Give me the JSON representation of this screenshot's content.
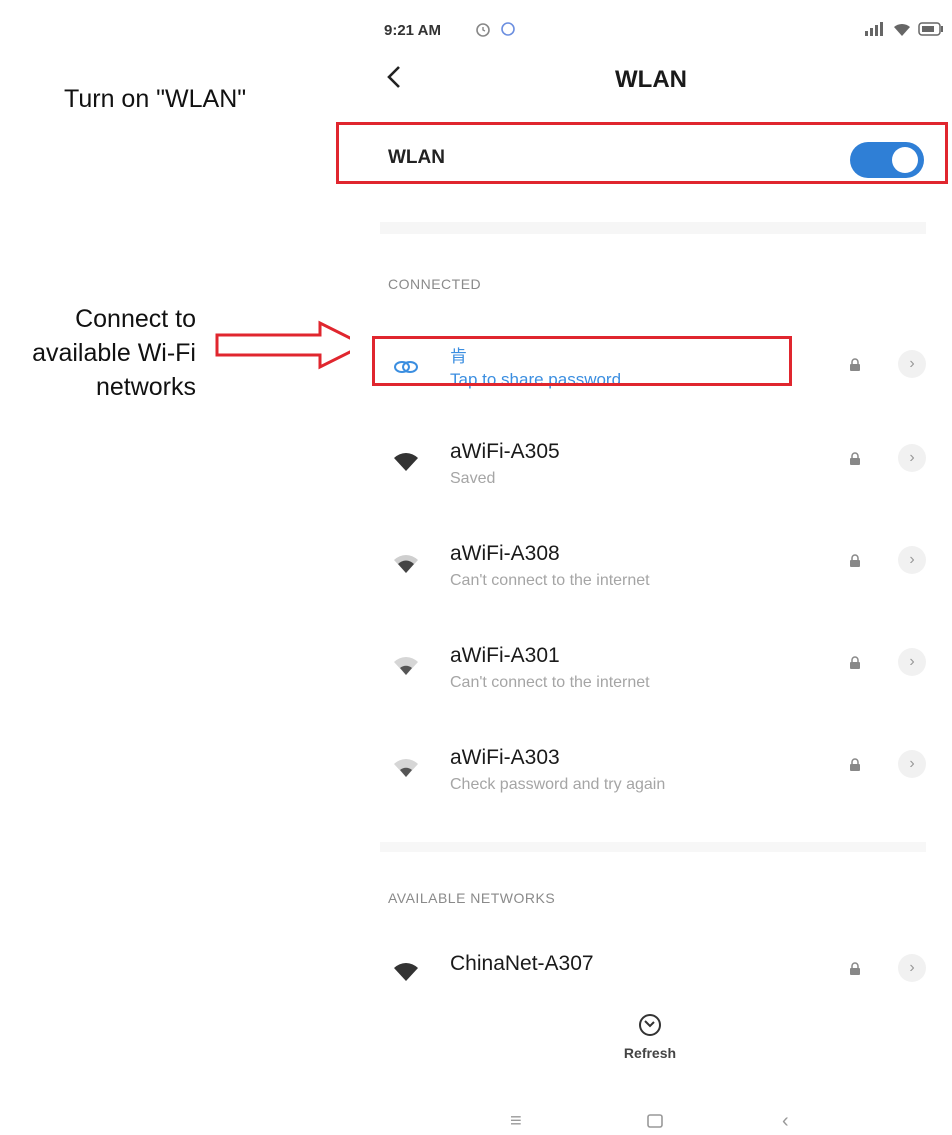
{
  "annotations": {
    "turn_on": "Turn on \"WLAN\"",
    "connect_line1": "Connect to",
    "connect_line2": "available Wi-Fi",
    "connect_line3": "networks"
  },
  "status_bar": {
    "time": "9:21 AM",
    "icons_left": [
      "alarm-icon",
      "sync-icon"
    ],
    "icons_right": [
      "signal-icon",
      "wifi-icon",
      "battery-icon"
    ]
  },
  "header": {
    "title": "WLAN"
  },
  "wlan": {
    "label": "WLAN",
    "enabled": true,
    "toggle_color": "#2f7fd6"
  },
  "sections": {
    "connected": "CONNECTED",
    "available": "AVAILABLE NETWORKS"
  },
  "connected_network": {
    "name": "肯",
    "status": "Tap to share password",
    "accent": "#3b8ee0"
  },
  "networks": [
    {
      "name": "aWiFi-A305",
      "status": "Saved"
    },
    {
      "name": "aWiFi-A308",
      "status": "Can't connect to the internet"
    },
    {
      "name": "aWiFi-A301",
      "status": "Can't connect to the internet"
    },
    {
      "name": "aWiFi-A303",
      "status": "Check password and try again"
    }
  ],
  "available_networks": [
    {
      "name": "ChinaNet-A307"
    }
  ],
  "refresh": {
    "label": "Refresh"
  },
  "highlight_color": "#e0262e"
}
